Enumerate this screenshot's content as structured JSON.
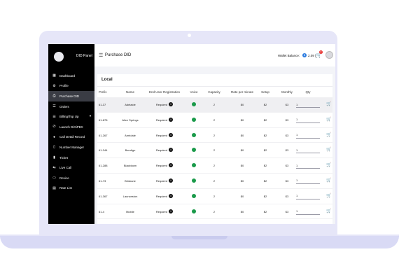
{
  "colors": {
    "lid": "#e6e6f8",
    "sidebar": "#000000",
    "active_item": "#3a3c44",
    "voice_on": "#1a9a4a",
    "badge": "#e8322f"
  },
  "sidebar": {
    "brand": "DID Panel",
    "items": [
      {
        "label": "Dashboard",
        "icon": "dashboard-icon",
        "active": false
      },
      {
        "label": "Profile",
        "icon": "gear-icon",
        "active": false
      },
      {
        "label": "Purchase DID",
        "icon": "printer-icon",
        "active": true
      },
      {
        "label": "Orders",
        "icon": "orders-icon",
        "active": false
      },
      {
        "label": "Billing/Top Up",
        "icon": "billing-icon",
        "active": false,
        "has_submenu": true
      },
      {
        "label": "Launch DiGiPBX",
        "icon": "phone-icon",
        "active": false
      },
      {
        "label": "Call Detail Record",
        "icon": "record-icon",
        "active": false
      },
      {
        "label": "Number Manager",
        "icon": "number-icon",
        "active": false
      },
      {
        "label": "Ticket",
        "icon": "ticket-icon",
        "active": false
      },
      {
        "label": "Live Call",
        "icon": "transfer-icon",
        "active": false
      },
      {
        "label": "Device",
        "icon": "device-icon",
        "active": false
      },
      {
        "label": "Rate List",
        "icon": "list-icon",
        "active": false
      }
    ]
  },
  "header": {
    "title": "Purchase DID",
    "wallet_label": "Wallet Balance:",
    "wallet_amount": "2.09",
    "cart_count": "0"
  },
  "table": {
    "section_title": "Local",
    "columns": [
      "Prefix",
      "Name",
      "End User Registration",
      "Voice",
      "Capacity",
      "Rate per minute",
      "Setup",
      "Monthly",
      "Qty"
    ],
    "rows": [
      {
        "prefix": "61-37",
        "name": "Adelaide",
        "registration": "Required",
        "voice": true,
        "capacity": "2",
        "rate": "$0",
        "setup": "$2",
        "monthly": "$3",
        "qty": "1"
      },
      {
        "prefix": "61-878",
        "name": "Alice Springs",
        "registration": "Required",
        "voice": true,
        "capacity": "2",
        "rate": "$0",
        "setup": "$2",
        "monthly": "$3",
        "qty": "1"
      },
      {
        "prefix": "61-267",
        "name": "Armidale",
        "registration": "Required",
        "voice": true,
        "capacity": "2",
        "rate": "$0",
        "setup": "$2",
        "monthly": "$3",
        "qty": "1"
      },
      {
        "prefix": "61-344",
        "name": "Bendigo",
        "registration": "Required",
        "voice": true,
        "capacity": "2",
        "rate": "$0",
        "setup": "$2",
        "monthly": "$3",
        "qty": "1"
      },
      {
        "prefix": "61-288",
        "name": "Blacktown",
        "registration": "Required",
        "voice": true,
        "capacity": "2",
        "rate": "$0",
        "setup": "$2",
        "monthly": "$3",
        "qty": "1"
      },
      {
        "prefix": "61-73",
        "name": "Brisbane",
        "registration": "Required",
        "voice": true,
        "capacity": "2",
        "rate": "$0",
        "setup": "$2",
        "monthly": "$3",
        "qty": "1"
      },
      {
        "prefix": "61-367",
        "name": "Launceston",
        "registration": "Required",
        "voice": true,
        "capacity": "2",
        "rate": "$0",
        "setup": "$2",
        "monthly": "$3",
        "qty": "1"
      },
      {
        "prefix": "61-4",
        "name": "Mobile",
        "registration": "Required",
        "voice": true,
        "capacity": "2",
        "rate": "$0",
        "setup": "$2",
        "monthly": "$3",
        "qty": "1"
      }
    ]
  }
}
